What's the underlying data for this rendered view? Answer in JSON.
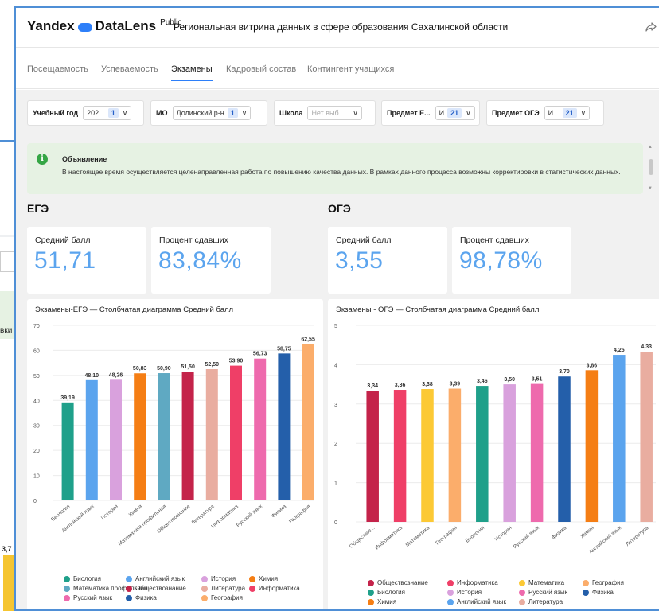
{
  "background_window": {
    "label_fragment": "вки",
    "value_label": "3,7"
  },
  "app": {
    "logo_text": "Yandex",
    "logo_product": "DataLens",
    "logo_badge": "Public",
    "dashboard_title": "Региональная витрина данных в сфере образования Сахалинской области"
  },
  "tabs": [
    {
      "label": "Посещаемость",
      "active": false
    },
    {
      "label": "Успеваемость",
      "active": false
    },
    {
      "label": "Экзамены",
      "active": true
    },
    {
      "label": "Кадровый состав",
      "active": false
    },
    {
      "label": "Контингент учащихся",
      "active": false
    }
  ],
  "filters": [
    {
      "label": "Учебный год",
      "value": "202...",
      "count": "1",
      "placeholder": false
    },
    {
      "label": "МО",
      "value": "Долинский р-н",
      "count": "1",
      "placeholder": false
    },
    {
      "label": "Школа",
      "value": "Нет выб...",
      "count": "",
      "placeholder": true
    },
    {
      "label": "Предмет Е...",
      "value": "И",
      "count": "21",
      "placeholder": false
    },
    {
      "label": "Предмет ОГЭ",
      "value": "И...",
      "count": "21",
      "placeholder": false
    }
  ],
  "notice": {
    "title": "Объявление",
    "text": "В настоящее время осуществляется целенаправленная работа по повышению качества данных. В рамках данного процесса возможны корректировки в статистических данных."
  },
  "ege": {
    "section_title": "ЕГЭ",
    "kpis": [
      {
        "label": "Средний балл",
        "value": "51,71"
      },
      {
        "label": "Процент сдавших",
        "value": "83,84%"
      }
    ]
  },
  "oge": {
    "section_title": "ОГЭ",
    "kpis": [
      {
        "label": "Средний балл",
        "value": "3,55"
      },
      {
        "label": "Процент сдавших",
        "value": "98,78%"
      }
    ]
  },
  "chart_data": [
    {
      "type": "bar",
      "title": "Экзамены-ЕГЭ — Столбчатая диаграмма Средний балл",
      "ylim": [
        0,
        70
      ],
      "yticks": [
        0,
        10,
        20,
        30,
        40,
        50,
        60,
        70
      ],
      "grid": true,
      "legend_position": "bottom",
      "categories": [
        "Биология",
        "Английский язык",
        "История",
        "Химия",
        "Математика профильная",
        "Обществознание",
        "Литература",
        "Информатика",
        "Русский язык",
        "Физика",
        "География"
      ],
      "values": [
        39.19,
        48.1,
        48.26,
        50.83,
        50.9,
        51.5,
        52.5,
        53.9,
        56.73,
        58.75,
        62.55
      ],
      "value_labels": [
        "39,19",
        "48,10",
        "48,26",
        "50,83",
        "50,90",
        "51,50",
        "52,50",
        "53,90",
        "56,73",
        "58,75",
        "62,55"
      ],
      "colors": [
        "#1fa08a",
        "#5ba4ee",
        "#d9a1dd",
        "#f57e14",
        "#5fa9c2",
        "#c4234a",
        "#e9ada0",
        "#ef3f67",
        "#ee6aad",
        "#245faa",
        "#fbad6b"
      ],
      "legend": [
        {
          "name": "Биология",
          "color": "#1fa08a"
        },
        {
          "name": "Английский язык",
          "color": "#5ba4ee"
        },
        {
          "name": "История",
          "color": "#d9a1dd"
        },
        {
          "name": "Химия",
          "color": "#f57e14"
        },
        {
          "name": "Математика профильная",
          "color": "#5fa9c2"
        },
        {
          "name": "Обществознание",
          "color": "#c4234a"
        },
        {
          "name": "Литература",
          "color": "#e9ada0"
        },
        {
          "name": "Информатика",
          "color": "#ef3f67"
        },
        {
          "name": "Русский язык",
          "color": "#ee6aad"
        },
        {
          "name": "Физика",
          "color": "#245faa"
        },
        {
          "name": "География",
          "color": "#fbad6b"
        }
      ]
    },
    {
      "type": "bar",
      "title": "Экзамены - ОГЭ — Столбчатая диаграмма Средний балл",
      "ylim": [
        0,
        5
      ],
      "yticks": [
        0,
        1,
        2,
        3,
        4,
        5
      ],
      "grid": true,
      "legend_position": "bottom",
      "categories": [
        "Обществоз...",
        "Информатика",
        "Математика",
        "География",
        "Биология",
        "История",
        "Русский язык",
        "Физика",
        "Химия",
        "Английский язык",
        "Литература"
      ],
      "values": [
        3.34,
        3.36,
        3.38,
        3.39,
        3.46,
        3.5,
        3.51,
        3.7,
        3.86,
        4.25,
        4.33
      ],
      "value_labels": [
        "3,34",
        "3,36",
        "3,38",
        "3,39",
        "3,46",
        "3,50",
        "3,51",
        "3,70",
        "3,86",
        "4,25",
        "4,33"
      ],
      "colors": [
        "#c4234a",
        "#ef3f67",
        "#fcc935",
        "#fbad6b",
        "#1fa08a",
        "#d9a1dd",
        "#ee6aad",
        "#245faa",
        "#f57e14",
        "#5ba4ee",
        "#e9ada0"
      ],
      "legend": [
        {
          "name": "Обществознание",
          "color": "#c4234a"
        },
        {
          "name": "Информатика",
          "color": "#ef3f67"
        },
        {
          "name": "Математика",
          "color": "#fcc935"
        },
        {
          "name": "География",
          "color": "#fbad6b"
        },
        {
          "name": "Биология",
          "color": "#1fa08a"
        },
        {
          "name": "История",
          "color": "#d9a1dd"
        },
        {
          "name": "Русский язык",
          "color": "#ee6aad"
        },
        {
          "name": "Физика",
          "color": "#245faa"
        },
        {
          "name": "Химия",
          "color": "#f57e14"
        },
        {
          "name": "Английский язык",
          "color": "#5ba4ee"
        },
        {
          "name": "Литература",
          "color": "#e9ada0"
        }
      ]
    }
  ]
}
